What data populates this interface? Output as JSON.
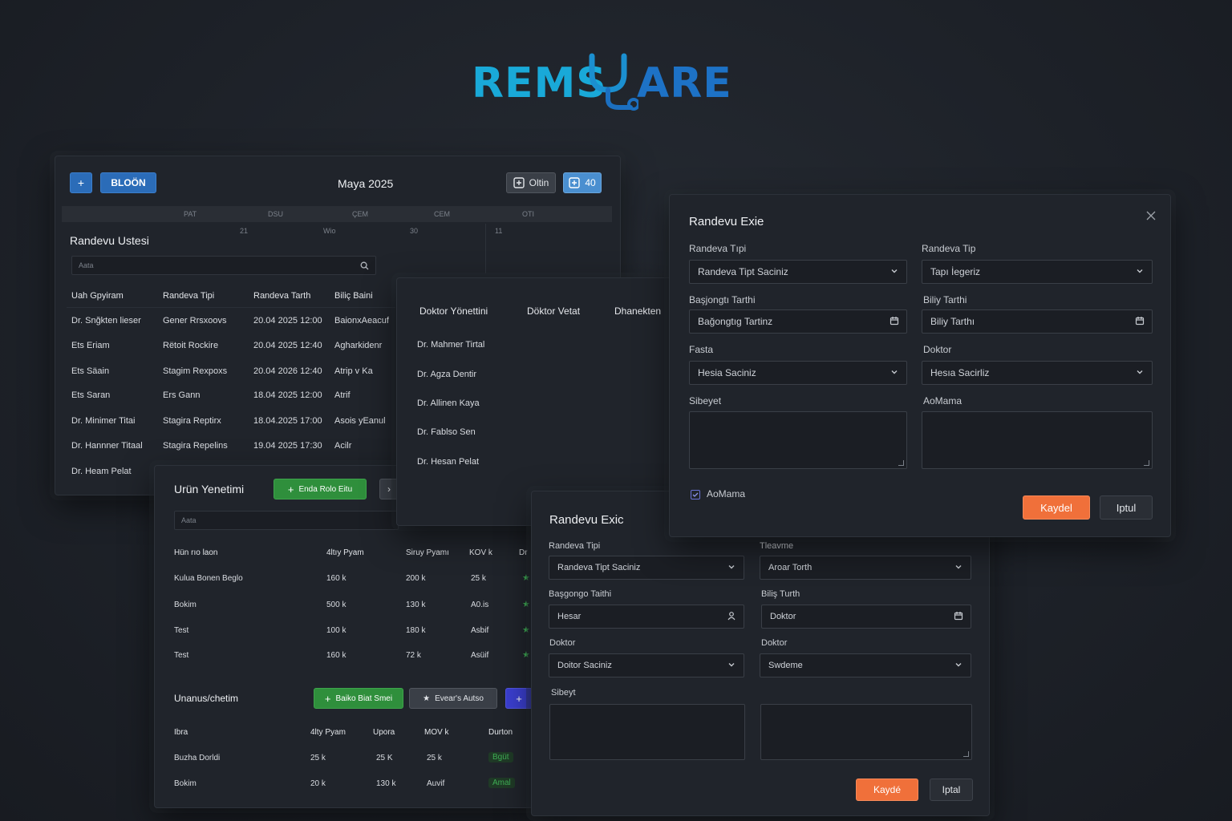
{
  "logo": {
    "left": "REMS",
    "right": "ARE"
  },
  "calendar": {
    "add_btn": "+",
    "bloon_btn": "BLOÖN",
    "month": "Maya 2025",
    "oltin_btn": "Oltin",
    "count_btn": "40",
    "weekdays": [
      "PAT",
      "DSU",
      "ÇEM",
      "CEM",
      "OTI"
    ],
    "days": [
      "21",
      "Wio",
      "30",
      "11"
    ]
  },
  "appt_list": {
    "title": "Randevu Ustesi",
    "search_placeholder": "Aata",
    "columns": [
      "Uah Gpyiram",
      "Randeva Tipi",
      "Randeva Tarth",
      "Biliç Baini"
    ],
    "rows": [
      [
        "Dr. Snğkten lieser",
        "Gener Rrsxoovs",
        "20.04 2025 12:00",
        "BaionxAeacuf"
      ],
      [
        "Ets Eriam",
        "Rëtoit Rockire",
        "20.04 2025 12:40",
        "Agharkidenr"
      ],
      [
        "Ets Säain",
        "Stagim Rexpoxs",
        "20.04 2026 12:40",
        "Atrip v Ka"
      ],
      [
        "Ets Saran",
        "Ers Gann",
        "18.04 2025 12:00",
        "Atrif"
      ],
      [
        "Dr.  Minimer Titai",
        "Stagira Reptirx",
        "18.04.2025 17:00",
        "Asois yEanul"
      ],
      [
        "Dr. Hannner Titaal",
        "Stagira Repelins",
        "19.04 2025 17:30",
        "Acilr"
      ],
      [
        "Dr. Heam Pelat",
        "",
        "",
        ""
      ]
    ]
  },
  "doctor_panel": {
    "tabs": [
      "Doktor Yönettini",
      "Döktor Vetat",
      "Dhanekten"
    ],
    "doctors": [
      "Dr. Mahmer Tirtal",
      "Dr. Agza Dentir",
      "Dr. Allinen Kaya",
      "Dr. Fablso Sen",
      "Dr. Hesan Pelat"
    ]
  },
  "product_panel": {
    "title": "Urün Yenetimi",
    "add_btn": "Enda Rolo Eitu",
    "search_placeholder": "Aata",
    "columns": [
      "Hün rıo laon",
      "4ltıy Pyam",
      "Siruy Pyamı",
      "KOV k",
      "Dr"
    ],
    "rows": [
      [
        "Kulua Bonen Beglo",
        "160 k",
        "200 k",
        "25 k"
      ],
      [
        "Bokim",
        "500 k",
        "130 k",
        "A0.is"
      ],
      [
        "Test",
        "100 k",
        "180 k",
        "Asbif"
      ],
      [
        "Test",
        "160 k",
        "72 k",
        "Asüif"
      ]
    ],
    "section2_title": "Unanus/chetim",
    "btn_green": "Baiko Biat Smei",
    "btn_star": "Evear's Autso",
    "btn_purple": "+",
    "columns2": [
      "Ibra",
      "4lty Pyam",
      "Upora",
      "MOV k",
      "Durton"
    ],
    "rows2": [
      [
        "Buzha Dorldi",
        "25 k",
        "25 K",
        "25 k",
        "Bgüt"
      ],
      [
        "Bokim",
        "20 k",
        "130 k",
        "Auvif",
        "Amal"
      ]
    ]
  },
  "modal_right": {
    "title": "Randevu Exie",
    "label_type": "Randeva Tıpi",
    "select_type": "Randeva Tipt Saciniz",
    "label_type2": "Randeva Tip",
    "select_type2": "Tapı İegeriz",
    "label_start": "Başjongtı Tarthi",
    "input_start": "Bağongtıg Tartinz",
    "label_end": "Biliy Tarthi",
    "input_end": "Biliy Tarthı",
    "label_hasta": "Fasta",
    "select_hasta": "Hesia Saciniz",
    "label_doktor": "Doktor",
    "select_doktor": "Hesıa Sacirliz",
    "label_note1": "Sibeyet",
    "label_note2": "AoMama",
    "checkbox_label": "AoMama",
    "save_btn": "Kaydel",
    "cancel_btn": "Iptul"
  },
  "modal_bottom": {
    "title": "Randevu Exic",
    "label_type": "Randeva Tipi",
    "select_type": "Randeva Tipt Saciniz",
    "label_type2": "Tleavme",
    "select_type2": "Aroar Torth",
    "label_start": "Başgongo Taithi",
    "input_start": "Hesar",
    "label_end": "Biliş Turth",
    "input_end": "Doktor",
    "label_doktor": "Doktor",
    "select_doktor": "Doitor Saciniz",
    "label_doktor2": "Doktor",
    "select_doktor2": "Swdeme",
    "label_note": "Sibeyt",
    "save_btn": "Kaydé",
    "cancel_btn": "Iptal"
  }
}
